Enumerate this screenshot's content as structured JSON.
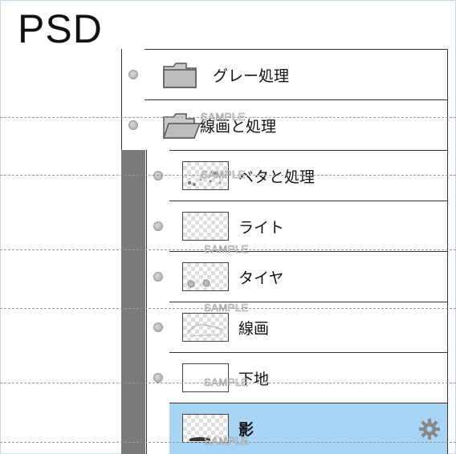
{
  "header": {
    "title": "PSD"
  },
  "layers": [
    {
      "name": "グレー処理",
      "type": "folder",
      "open": false,
      "indent": 0,
      "selected": false
    },
    {
      "name": "線画と処理",
      "type": "folder",
      "open": true,
      "indent": 0,
      "selected": false
    },
    {
      "name": "ベタと処理",
      "type": "layer",
      "indent": 1,
      "selected": false,
      "thumb": "spots"
    },
    {
      "name": "ライト",
      "type": "layer",
      "indent": 1,
      "selected": false,
      "thumb": "blank"
    },
    {
      "name": "タイヤ",
      "type": "layer",
      "indent": 1,
      "selected": false,
      "thumb": "tires"
    },
    {
      "name": "線画",
      "type": "layer",
      "indent": 1,
      "selected": false,
      "thumb": "lines"
    },
    {
      "name": "下地",
      "type": "layer",
      "indent": 1,
      "selected": false,
      "thumb": "blank"
    },
    {
      "name": "影",
      "type": "layer",
      "indent": 1,
      "selected": true,
      "thumb": "shadow",
      "gear": true
    }
  ],
  "watermark": {
    "text": "SAMPLE"
  },
  "colors": {
    "selected_row": "#a8d4f6",
    "indent_bar": "#7a7a7a",
    "gear": "#888888"
  }
}
